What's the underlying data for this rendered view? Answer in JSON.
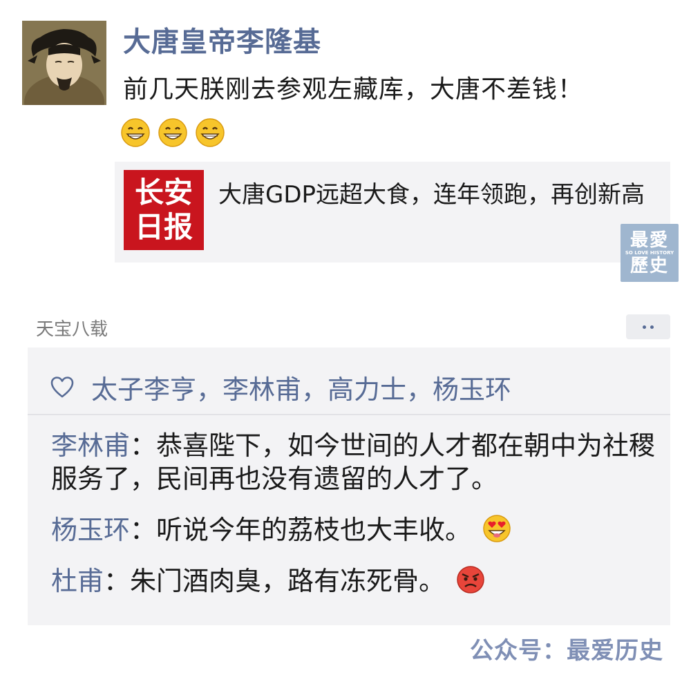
{
  "post": {
    "username": "大唐皇帝李隆基",
    "text": "前几天朕刚去参观左藏库，大唐不差钱！",
    "emojis": [
      "grin-emoji",
      "grin-emoji",
      "grin-emoji"
    ],
    "link_card": {
      "thumb_line1": "长安",
      "thumb_line2": "日报",
      "title": "大唐GDP远超大食，连年领跑，再创新高"
    },
    "watermark": {
      "line1": "最愛",
      "small": "SO LOVE HISTORY",
      "line2": "歷史"
    },
    "timestamp": "天宝八载"
  },
  "likes": {
    "icon": "heart-icon",
    "names": "太子李亨，李林甫，高力士，杨玉环"
  },
  "comments": [
    {
      "author": "李林甫",
      "separator": "：",
      "text": "恭喜陛下，如今世间的人才都在朝中为社稷服务了，民间再也没有遗留的人才了。",
      "emoji": ""
    },
    {
      "author": "杨玉环",
      "separator": "：",
      "text": "听说今年的荔枝也大丰收。",
      "emoji": "heart-eyes-emoji"
    },
    {
      "author": "杜甫",
      "separator": "：",
      "text": "朱门酒肉臭，路有冻死骨。",
      "emoji": "angry-face-emoji"
    }
  ],
  "footer": {
    "text": "公众号：最爱历史"
  },
  "colors": {
    "link_blue": "#576b95",
    "panel_bg": "#f3f3f5",
    "news_red": "#c9151e"
  }
}
